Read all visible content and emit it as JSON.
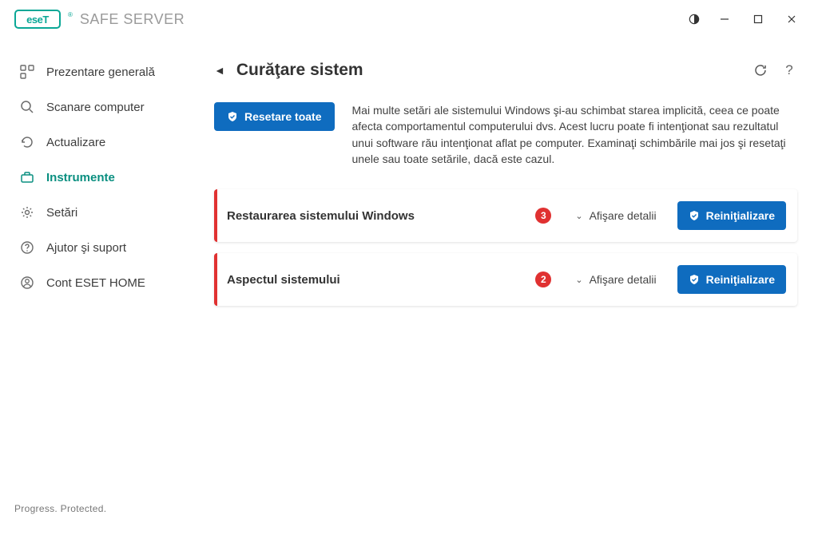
{
  "app": {
    "logo_text": "eseT",
    "title": "SAFE SERVER"
  },
  "sidebar": {
    "items": [
      {
        "label": "Prezentare generală"
      },
      {
        "label": "Scanare computer"
      },
      {
        "label": "Actualizare"
      },
      {
        "label": "Instrumente"
      },
      {
        "label": "Setări"
      },
      {
        "label": "Ajutor şi suport"
      },
      {
        "label": "Cont ESET HOME"
      }
    ],
    "tagline": "Progress. Protected."
  },
  "page": {
    "title": "Curăţare sistem",
    "reset_all": "Resetare toate",
    "intro": "Mai multe setări ale sistemului Windows şi-au schimbat starea implicită, ceea ce poate afecta comportamentul computerului dvs. Acest lucru poate fi intenţionat sau rezultatul unui software rău intenţionat aflat pe computer. Examinaţi schimbările mai jos şi resetaţi unele sau toate setările, dacă este cazul."
  },
  "labels": {
    "show_details": "Afişare detalii",
    "reset": "Reiniţializare"
  },
  "items": [
    {
      "title": "Restaurarea sistemului Windows",
      "count": "3"
    },
    {
      "title": "Aspectul sistemului",
      "count": "2"
    }
  ]
}
